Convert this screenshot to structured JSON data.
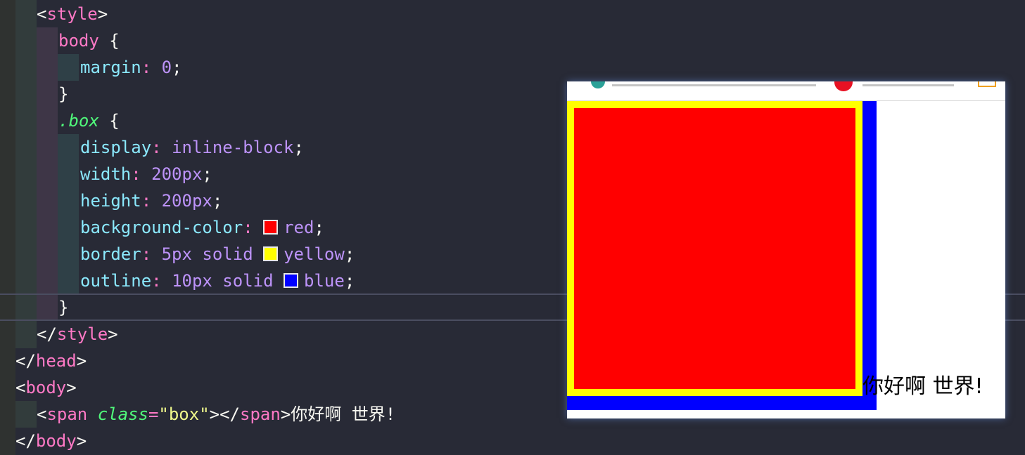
{
  "editor": {
    "lines": [
      {
        "tokens": [
          {
            "t": "<",
            "c": "punc"
          },
          {
            "t": "style",
            "c": "tag"
          },
          {
            "t": ">",
            "c": "punc"
          }
        ]
      },
      {
        "tokens": [
          {
            "t": "body",
            "c": "tag"
          },
          {
            "t": " {",
            "c": "punc"
          }
        ]
      },
      {
        "tokens": [
          {
            "t": "margin",
            "c": "prop"
          },
          {
            "t": ": ",
            "c": "tag"
          },
          {
            "t": "0",
            "c": "val"
          },
          {
            "t": ";",
            "c": "punc"
          }
        ]
      },
      {
        "tokens": [
          {
            "t": "}",
            "c": "punc"
          }
        ]
      },
      {
        "tokens": [
          {
            "t": ".box",
            "c": "cls"
          },
          {
            "t": " {",
            "c": "punc"
          }
        ]
      },
      {
        "tokens": [
          {
            "t": "display",
            "c": "prop"
          },
          {
            "t": ": ",
            "c": "tag"
          },
          {
            "t": "inline-block",
            "c": "val"
          },
          {
            "t": ";",
            "c": "punc"
          }
        ]
      },
      {
        "tokens": [
          {
            "t": "width",
            "c": "prop"
          },
          {
            "t": ": ",
            "c": "tag"
          },
          {
            "t": "200px",
            "c": "val"
          },
          {
            "t": ";",
            "c": "punc"
          }
        ]
      },
      {
        "tokens": [
          {
            "t": "height",
            "c": "prop"
          },
          {
            "t": ": ",
            "c": "tag"
          },
          {
            "t": "200px",
            "c": "val"
          },
          {
            "t": ";",
            "c": "punc"
          }
        ]
      },
      {
        "tokens": [
          {
            "t": "background-color",
            "c": "prop"
          },
          {
            "t": ": ",
            "c": "tag"
          },
          {
            "swatch": "#ff0000"
          },
          {
            "t": "red",
            "c": "val"
          },
          {
            "t": ";",
            "c": "punc"
          }
        ]
      },
      {
        "tokens": [
          {
            "t": "border",
            "c": "prop"
          },
          {
            "t": ": ",
            "c": "tag"
          },
          {
            "t": "5px solid ",
            "c": "val"
          },
          {
            "swatch": "#ffff00"
          },
          {
            "t": "yellow",
            "c": "val"
          },
          {
            "t": ";",
            "c": "punc"
          }
        ]
      },
      {
        "tokens": [
          {
            "t": "outline",
            "c": "prop"
          },
          {
            "t": ": ",
            "c": "tag"
          },
          {
            "t": "10px solid ",
            "c": "val"
          },
          {
            "swatch": "#0000ff"
          },
          {
            "t": "blue",
            "c": "val"
          },
          {
            "t": ";",
            "c": "punc"
          }
        ]
      },
      {
        "tokens": [
          {
            "t": "}",
            "c": "punc"
          }
        ]
      },
      {
        "tokens": [
          {
            "t": "</",
            "c": "punc"
          },
          {
            "t": "style",
            "c": "tag"
          },
          {
            "t": ">",
            "c": "punc"
          }
        ]
      },
      {
        "tokens": [
          {
            "t": "</",
            "c": "punc"
          },
          {
            "t": "head",
            "c": "tag"
          },
          {
            "t": ">",
            "c": "punc"
          }
        ]
      },
      {
        "tokens": [
          {
            "t": "<",
            "c": "punc"
          },
          {
            "t": "body",
            "c": "tag"
          },
          {
            "t": ">",
            "c": "punc"
          }
        ]
      },
      {
        "tokens": [
          {
            "t": "<",
            "c": "punc"
          },
          {
            "t": "span",
            "c": "tag"
          },
          {
            "t": " ",
            "c": "punc"
          },
          {
            "t": "class",
            "c": "cls"
          },
          {
            "t": "=",
            "c": "tag"
          },
          {
            "t": "\"box\"",
            "c": "str"
          },
          {
            "t": "></",
            "c": "punc"
          },
          {
            "t": "span",
            "c": "tag"
          },
          {
            "t": ">你好啊 世界!",
            "c": "punc"
          }
        ]
      },
      {
        "tokens": [
          {
            "t": "</",
            "c": "punc"
          },
          {
            "t": "body",
            "c": "tag"
          },
          {
            "t": ">",
            "c": "punc"
          }
        ]
      }
    ]
  },
  "preview": {
    "text": "你好啊 世界!",
    "box_background": "#ff0000",
    "box_border": "#ffff00",
    "box_outline": "#0000ff"
  }
}
